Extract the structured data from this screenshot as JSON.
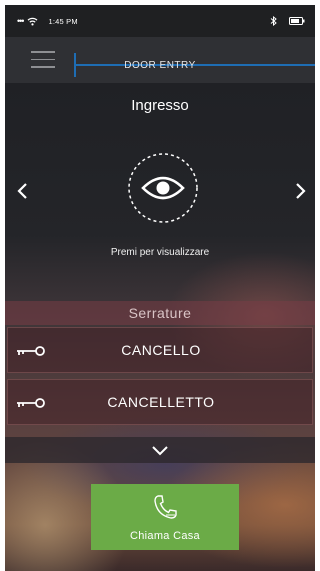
{
  "status_bar": {
    "time": "1:45 PM"
  },
  "header": {
    "title": "DOOR ENTRY"
  },
  "camera": {
    "name": "Ingresso",
    "view_hint": "Premi per visualizzare"
  },
  "locks": {
    "header": "Serrature",
    "items": [
      {
        "label": "CANCELLO"
      },
      {
        "label": "CANCELLETTO"
      }
    ]
  },
  "call": {
    "label": "Chiama Casa"
  },
  "colors": {
    "accent_blue": "#1e6db4",
    "call_green": "#6bab47"
  }
}
